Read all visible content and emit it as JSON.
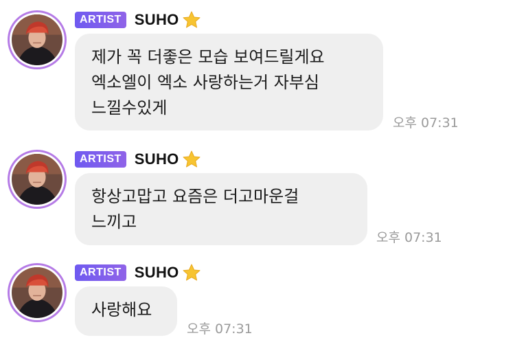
{
  "messages": [
    {
      "badge": "ARTIST",
      "sender": "SUHO",
      "lines": [
        "제가 꼭 더좋은 모습 보여드릴게요",
        "엑소엘이 엑소 사랑하는거 자부심",
        "느낄수있게"
      ],
      "time": "오후 07:31"
    },
    {
      "badge": "ARTIST",
      "sender": "SUHO",
      "lines": [
        "항상고맙고 요즘은 더고마운걸",
        "느끼고"
      ],
      "time": "오후 07:31"
    },
    {
      "badge": "ARTIST",
      "sender": "SUHO",
      "lines": [
        "사랑해요"
      ],
      "time": "오후 07:31"
    }
  ],
  "icons": {
    "star": "star-icon",
    "avatar": "artist-avatar"
  },
  "colors": {
    "badge_start": "#6f5af0",
    "badge_end": "#8f63e8",
    "avatar_ring": "#b57be6",
    "bubble": "#efefef",
    "star": "#f7c431",
    "time": "#9a9a9a"
  }
}
